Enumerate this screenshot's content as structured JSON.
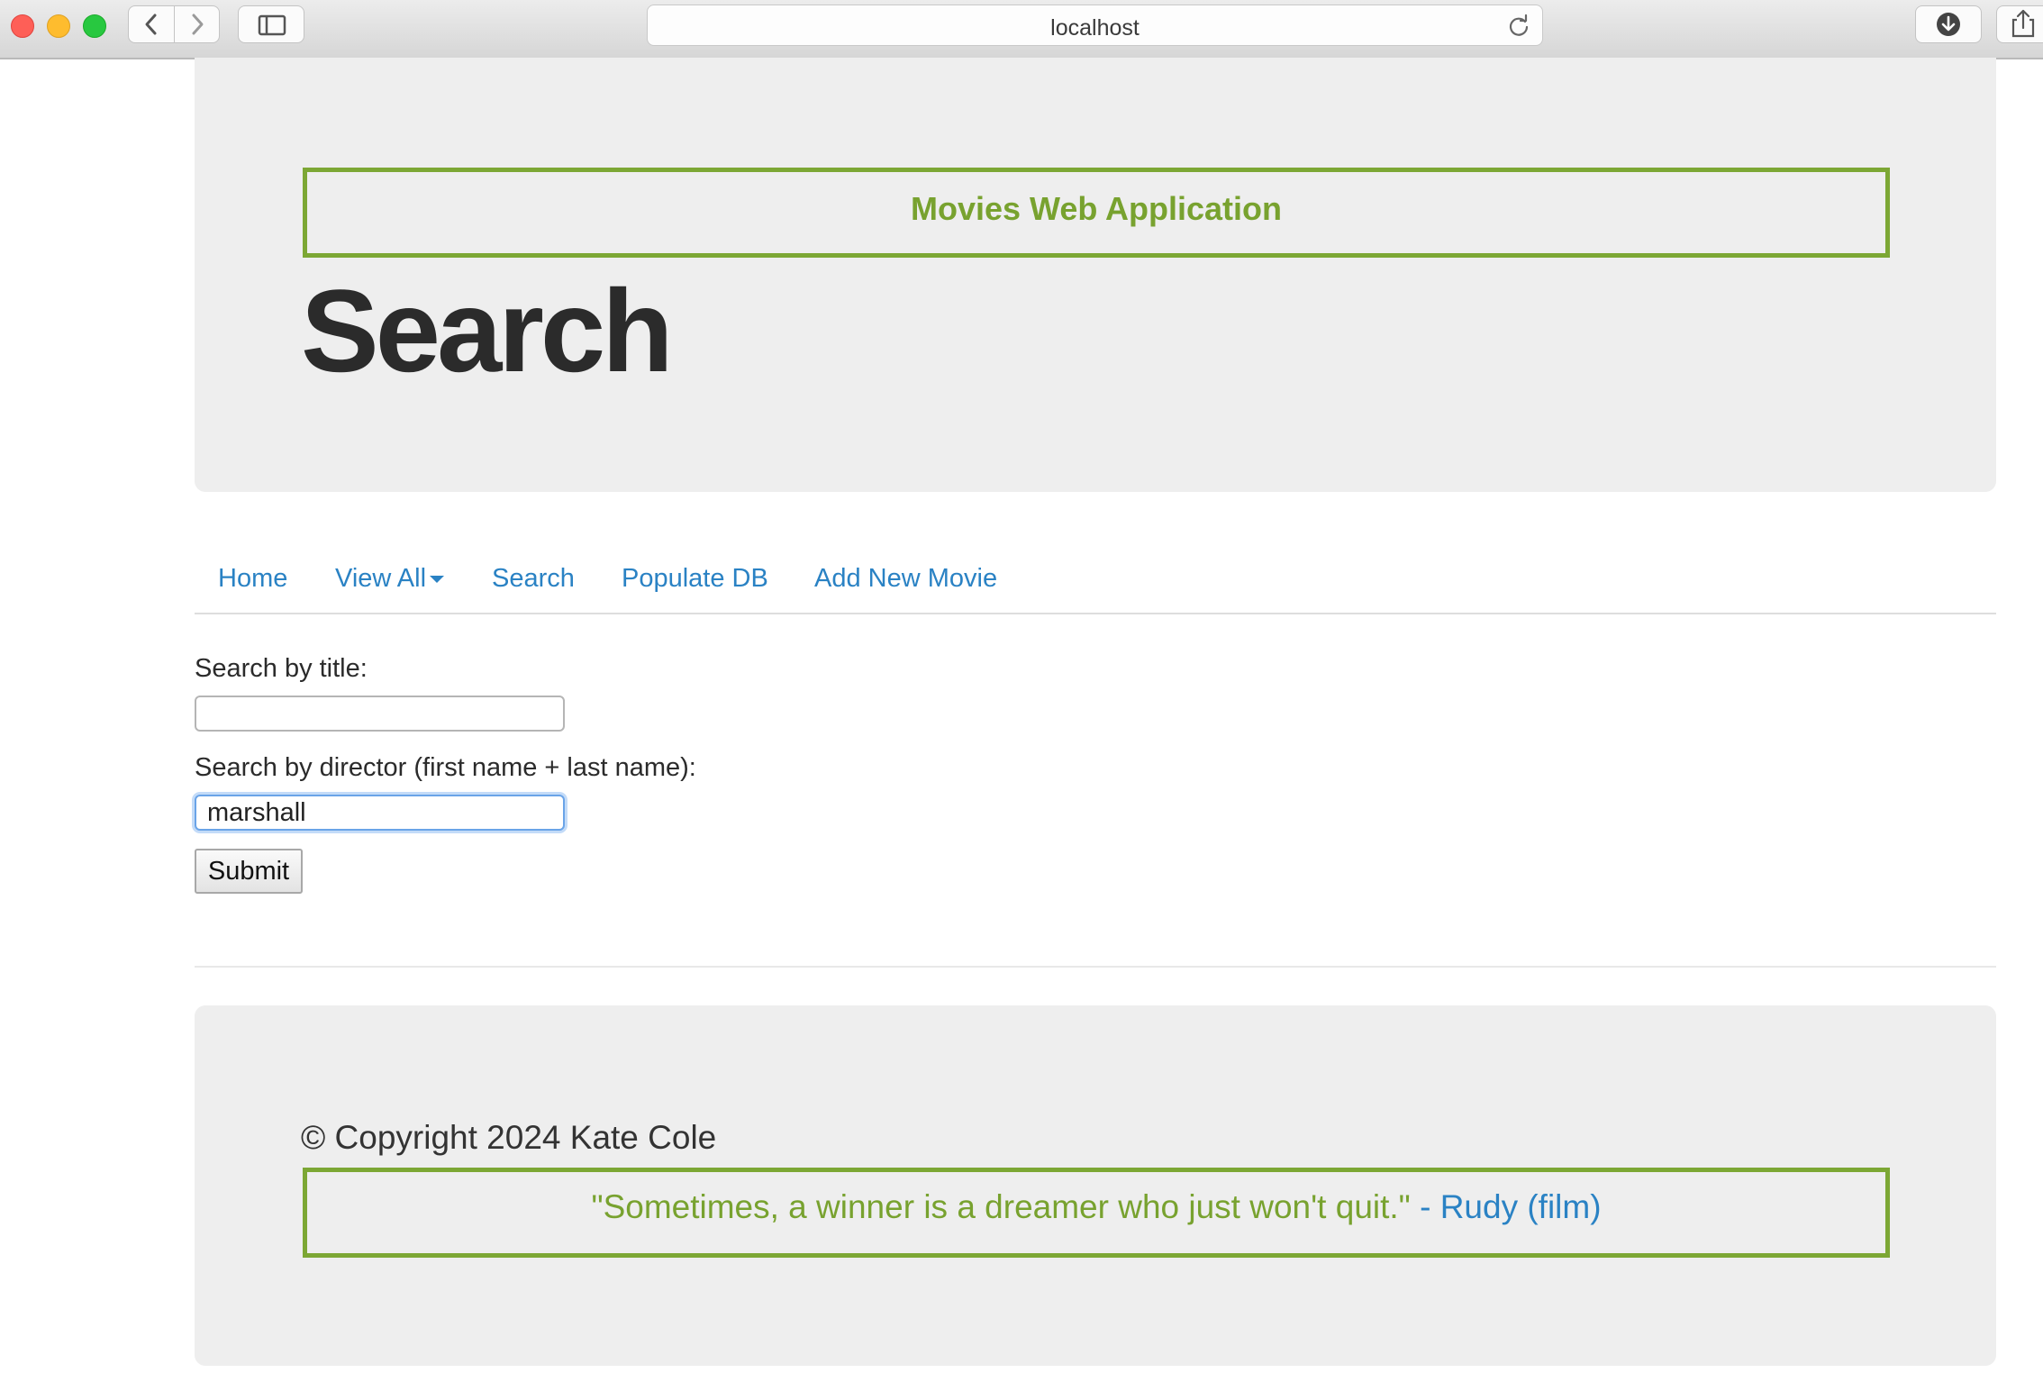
{
  "browser": {
    "address": "localhost"
  },
  "header": {
    "app_title": "Movies Web Application",
    "heading": "Search"
  },
  "nav": {
    "items": [
      {
        "label": "Home"
      },
      {
        "label": "View All"
      },
      {
        "label": "Search"
      },
      {
        "label": "Populate DB"
      },
      {
        "label": "Add New Movie"
      }
    ]
  },
  "form": {
    "title_label": "Search by title:",
    "title_value": "",
    "director_label": "Search by director (first name + last name):",
    "director_value": "marshall",
    "submit_label": "Submit"
  },
  "footer": {
    "copyright": "© Copyright 2024 Kate Cole",
    "quote": "\"Sometimes, a winner is a dreamer who just won't quit.\"",
    "quote_separator": " - ",
    "quote_source": "Rudy (film)"
  },
  "colors": {
    "accent_green": "#7ca734",
    "link_blue": "#2a82c4",
    "panel_gray": "#eeeeee"
  }
}
